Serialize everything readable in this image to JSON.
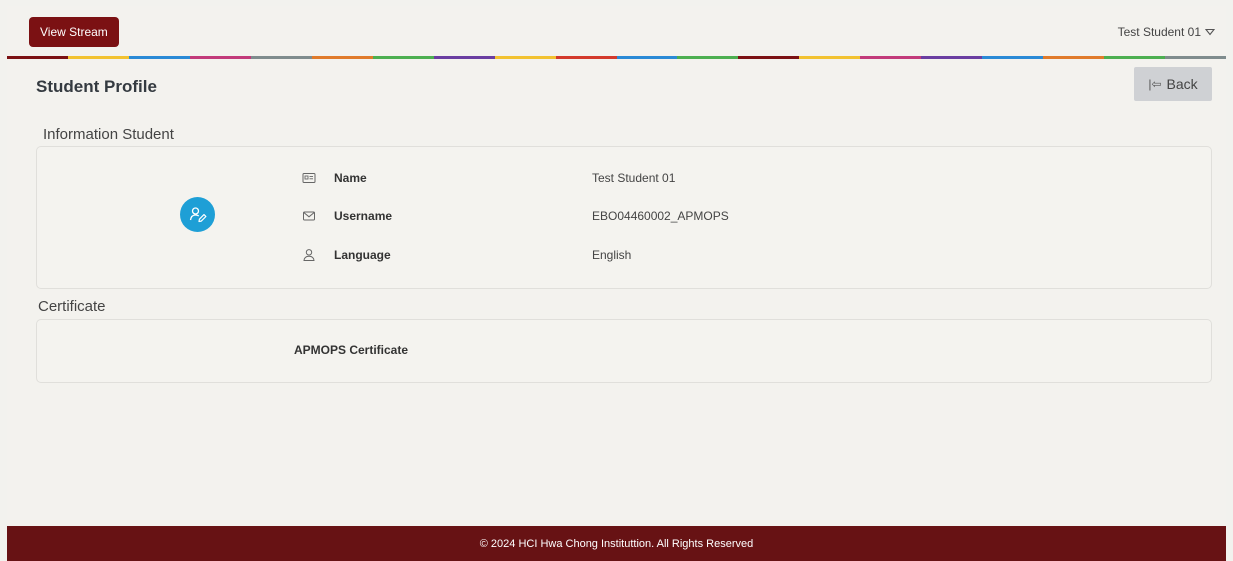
{
  "header": {
    "view_stream_label": "View Stream",
    "user_name": "Test Student 01",
    "rainbow_colors": [
      "#7b1113",
      "#f2c230",
      "#2a8ad6",
      "#c23b7a",
      "#7f8c8d",
      "#e07b2b",
      "#4caf50",
      "#6a3ea1",
      "#f2c230",
      "#d33a2c",
      "#2a8ad6",
      "#4caf50",
      "#7b1113",
      "#f2c230",
      "#c23b7a",
      "#6a3ea1",
      "#2a8ad6",
      "#e07b2b",
      "#4caf50",
      "#7f8c8d"
    ]
  },
  "page": {
    "title": "Student Profile",
    "back_label": "Back"
  },
  "info_section": {
    "heading": "Information Student",
    "avatar_icon": "user-edit-icon",
    "avatar_color": "#1e9fd6",
    "fields": [
      {
        "icon": "id-card-icon",
        "label": "Name",
        "value": "Test Student 01"
      },
      {
        "icon": "envelope-icon",
        "label": "Username",
        "value": "EBO04460002_APMOPS"
      },
      {
        "icon": "user-icon",
        "label": "Language",
        "value": "English"
      }
    ]
  },
  "certificate_section": {
    "heading": "Certificate",
    "certificate_name": "APMOPS Certificate"
  },
  "footer": {
    "text": "© 2024 HCI Hwa Chong Instituttion. All Rights Reserved"
  }
}
